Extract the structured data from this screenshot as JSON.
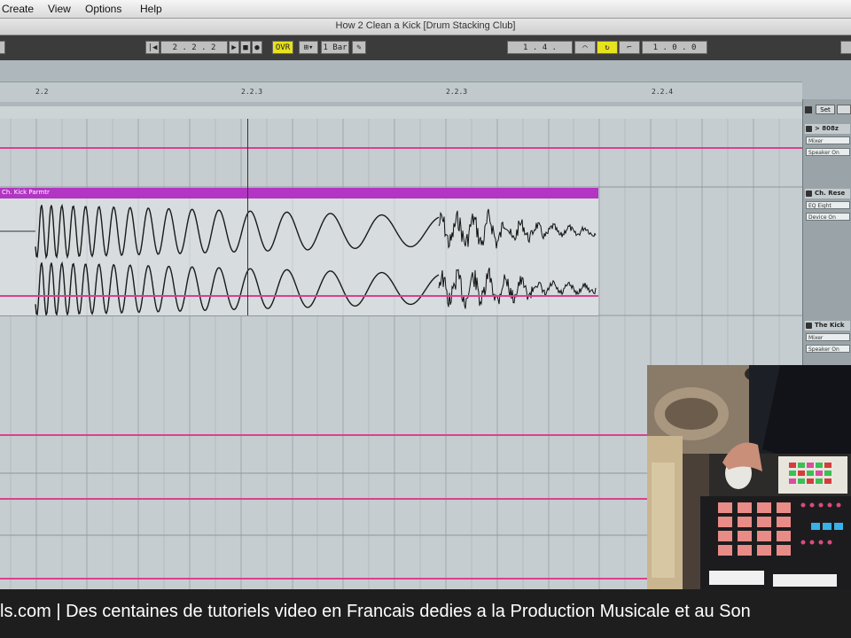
{
  "menubar": {
    "items": [
      "Create",
      "View",
      "Options",
      "Help"
    ]
  },
  "window": {
    "title": "How 2 Clean a Kick  [Drum Stacking Club]"
  },
  "transport": {
    "position": "2 . 2 . 2",
    "ovr_label": "OVR",
    "quantize": "1 Bar",
    "loop_start": "1 . 4 .",
    "loop_length": "1 . 0 . 0"
  },
  "ruler": {
    "markers": [
      "2.2",
      "2.2.3",
      "2.2.3",
      "2.2.4"
    ]
  },
  "clip": {
    "name": "Ch. Kick Parmtr"
  },
  "tracks": [
    {
      "name": "> 808z",
      "sub1": "Mixer",
      "sub2": "Speaker On"
    },
    {
      "name": "Ch. Rese",
      "sub1": "EQ Eight",
      "sub2": "Device On"
    },
    {
      "name": "The Kick",
      "sub1": "Mixer",
      "sub2": "Speaker On"
    }
  ],
  "right_header": {
    "set_label": "Set"
  },
  "caption": {
    "text": "ls.com | Des centaines de tutoriels video en Francais dedies a la Production Musicale et au Son"
  },
  "colors": {
    "clip_header": "#b235c4",
    "automation": "#d9418f",
    "transport_active": "#e7e21f"
  }
}
